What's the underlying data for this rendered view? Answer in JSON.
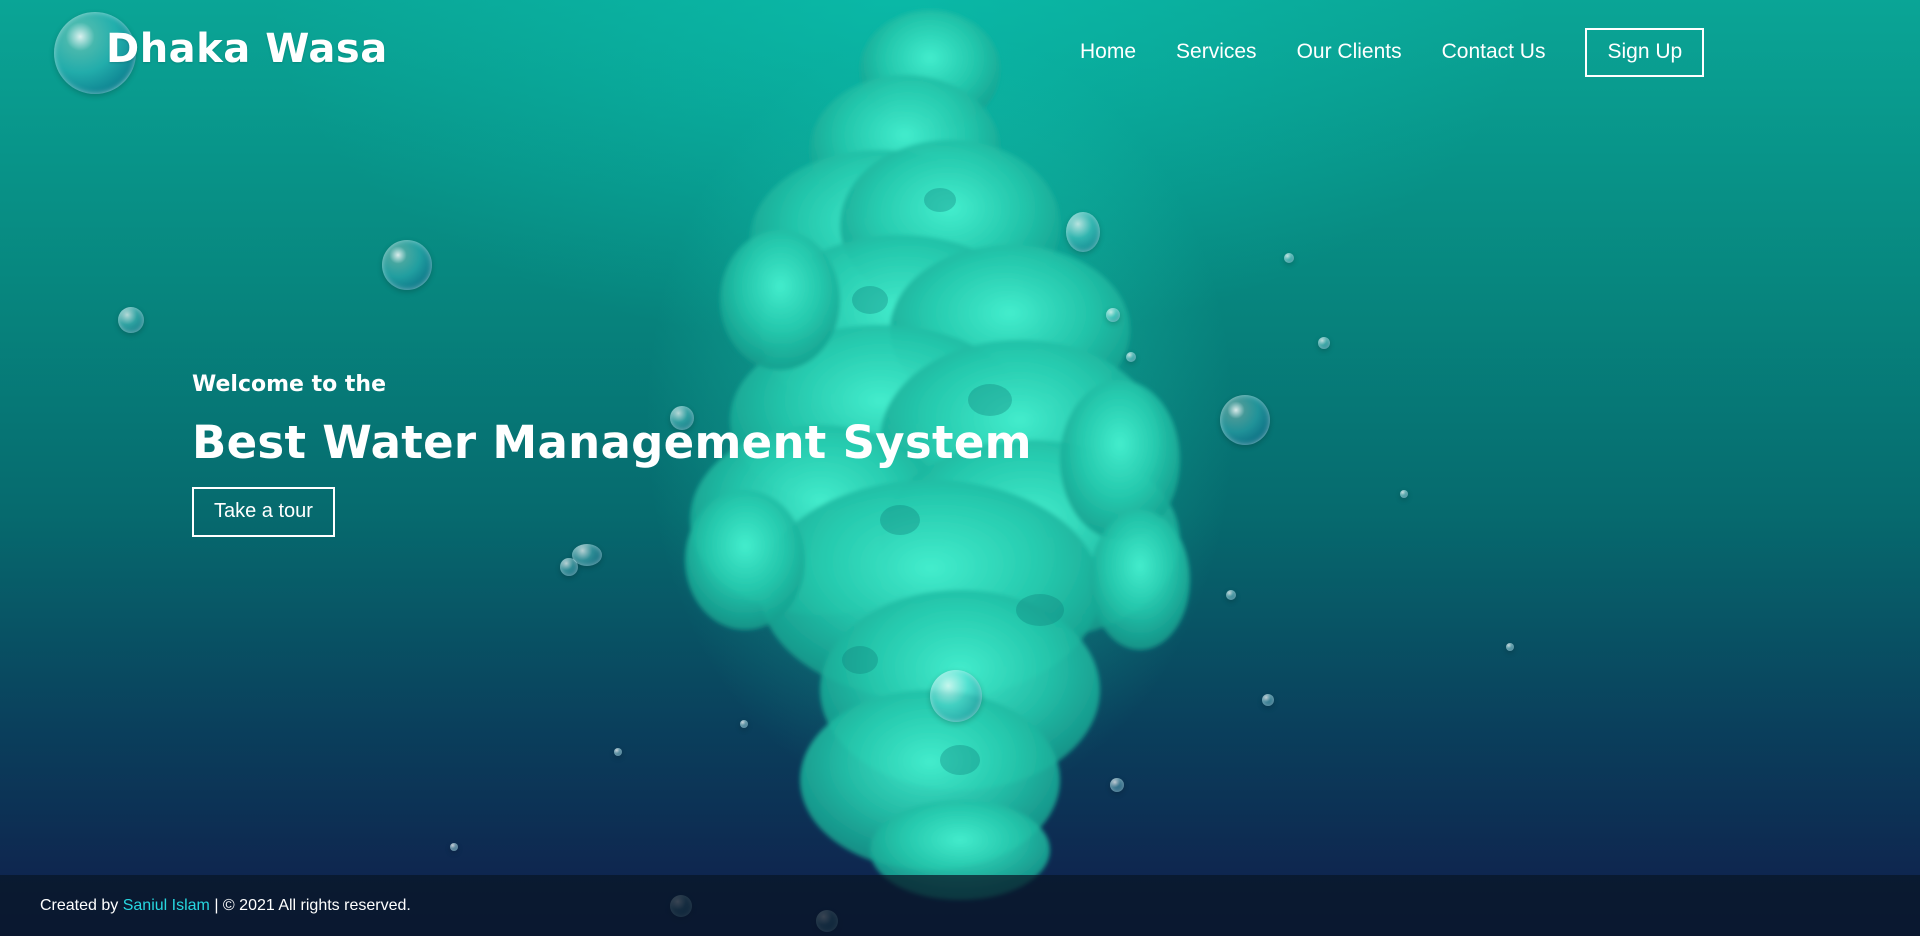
{
  "brand": {
    "name": "Dhaka Wasa"
  },
  "nav": {
    "items": [
      {
        "label": "Home"
      },
      {
        "label": "Services"
      },
      {
        "label": "Our Clients"
      },
      {
        "label": "Contact Us"
      }
    ],
    "signup_label": "Sign Up"
  },
  "hero": {
    "welcome": "Welcome to the",
    "title": "Best Water Management System",
    "cta_label": "Take a tour"
  },
  "footer": {
    "created_by": "Created by",
    "author": "Saniul Islam",
    "rights": "| © 2021 All rights reserved."
  },
  "colors": {
    "accent": "#27d7e0",
    "text": "#ffffff",
    "footer_bg": "#0c1a2a",
    "ink": "#2fd9bf"
  }
}
